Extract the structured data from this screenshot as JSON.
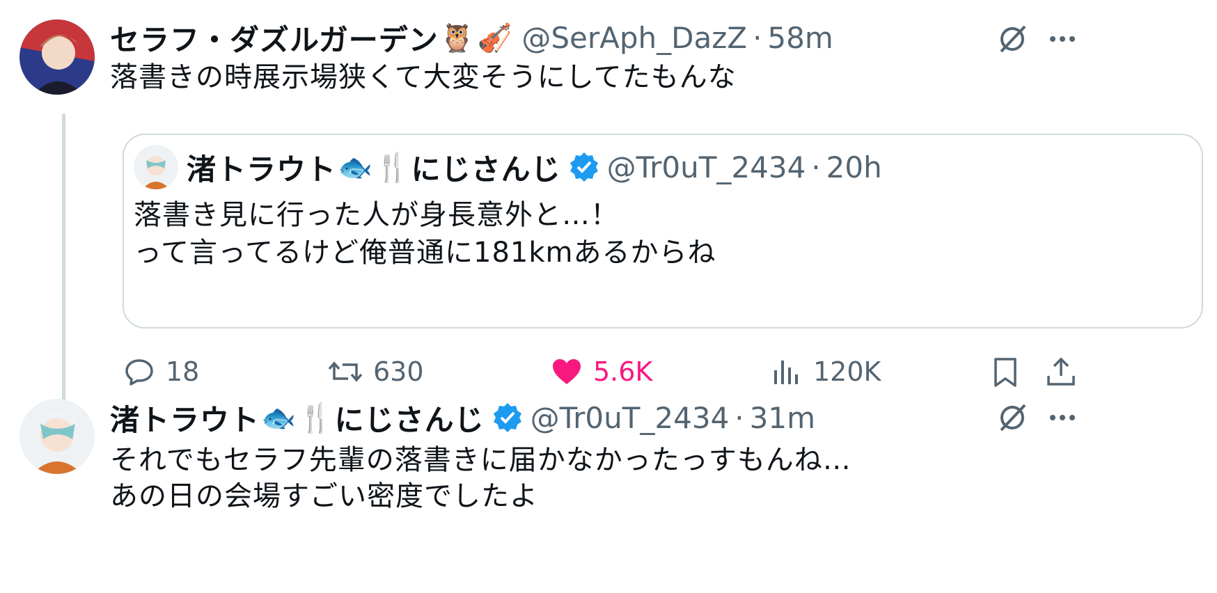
{
  "tweet1": {
    "display_name": "セラフ・ダズルガーデン",
    "name_emojis": [
      "🦉",
      "🎻"
    ],
    "handle": "@SerAph_DazZ",
    "separator": "·",
    "time": "58m",
    "text": "落書きの時展示場狭くて大変そうにしてたもんな"
  },
  "quoted": {
    "display_name_part1": "渚トラウト",
    "name_emojis": [
      "🐟",
      "🍴"
    ],
    "display_name_part2": "にじさんじ",
    "handle": "@Tr0uT_2434",
    "separator": "·",
    "time": "20h",
    "text_line1": "落書き見に行った人が身長意外と…！",
    "text_line2": "って言ってるけど俺普通に181kmあるからね"
  },
  "actions": {
    "replies": "18",
    "reposts": "630",
    "likes": "5.6K",
    "views": "120K"
  },
  "tweet2": {
    "display_name_part1": "渚トラウト",
    "name_emojis": [
      "🐟",
      "🍴"
    ],
    "display_name_part2": "にじさんじ",
    "handle": "@Tr0uT_2434",
    "separator": "·",
    "time": "31m",
    "text_line1": "それでもセラフ先輩の落書きに届かなかったっすもんね…",
    "text_line2": "あの日の会場すごい密度でしたよ"
  },
  "colors": {
    "like": "#f91880",
    "verified": "#1d9bf0",
    "secondary_text": "#536471",
    "border": "#cfd9de"
  },
  "icons": [
    "grok-icon",
    "more-icon",
    "reply-icon",
    "repost-icon",
    "like-icon",
    "views-icon",
    "bookmark-icon",
    "share-icon",
    "verified-icon"
  ]
}
